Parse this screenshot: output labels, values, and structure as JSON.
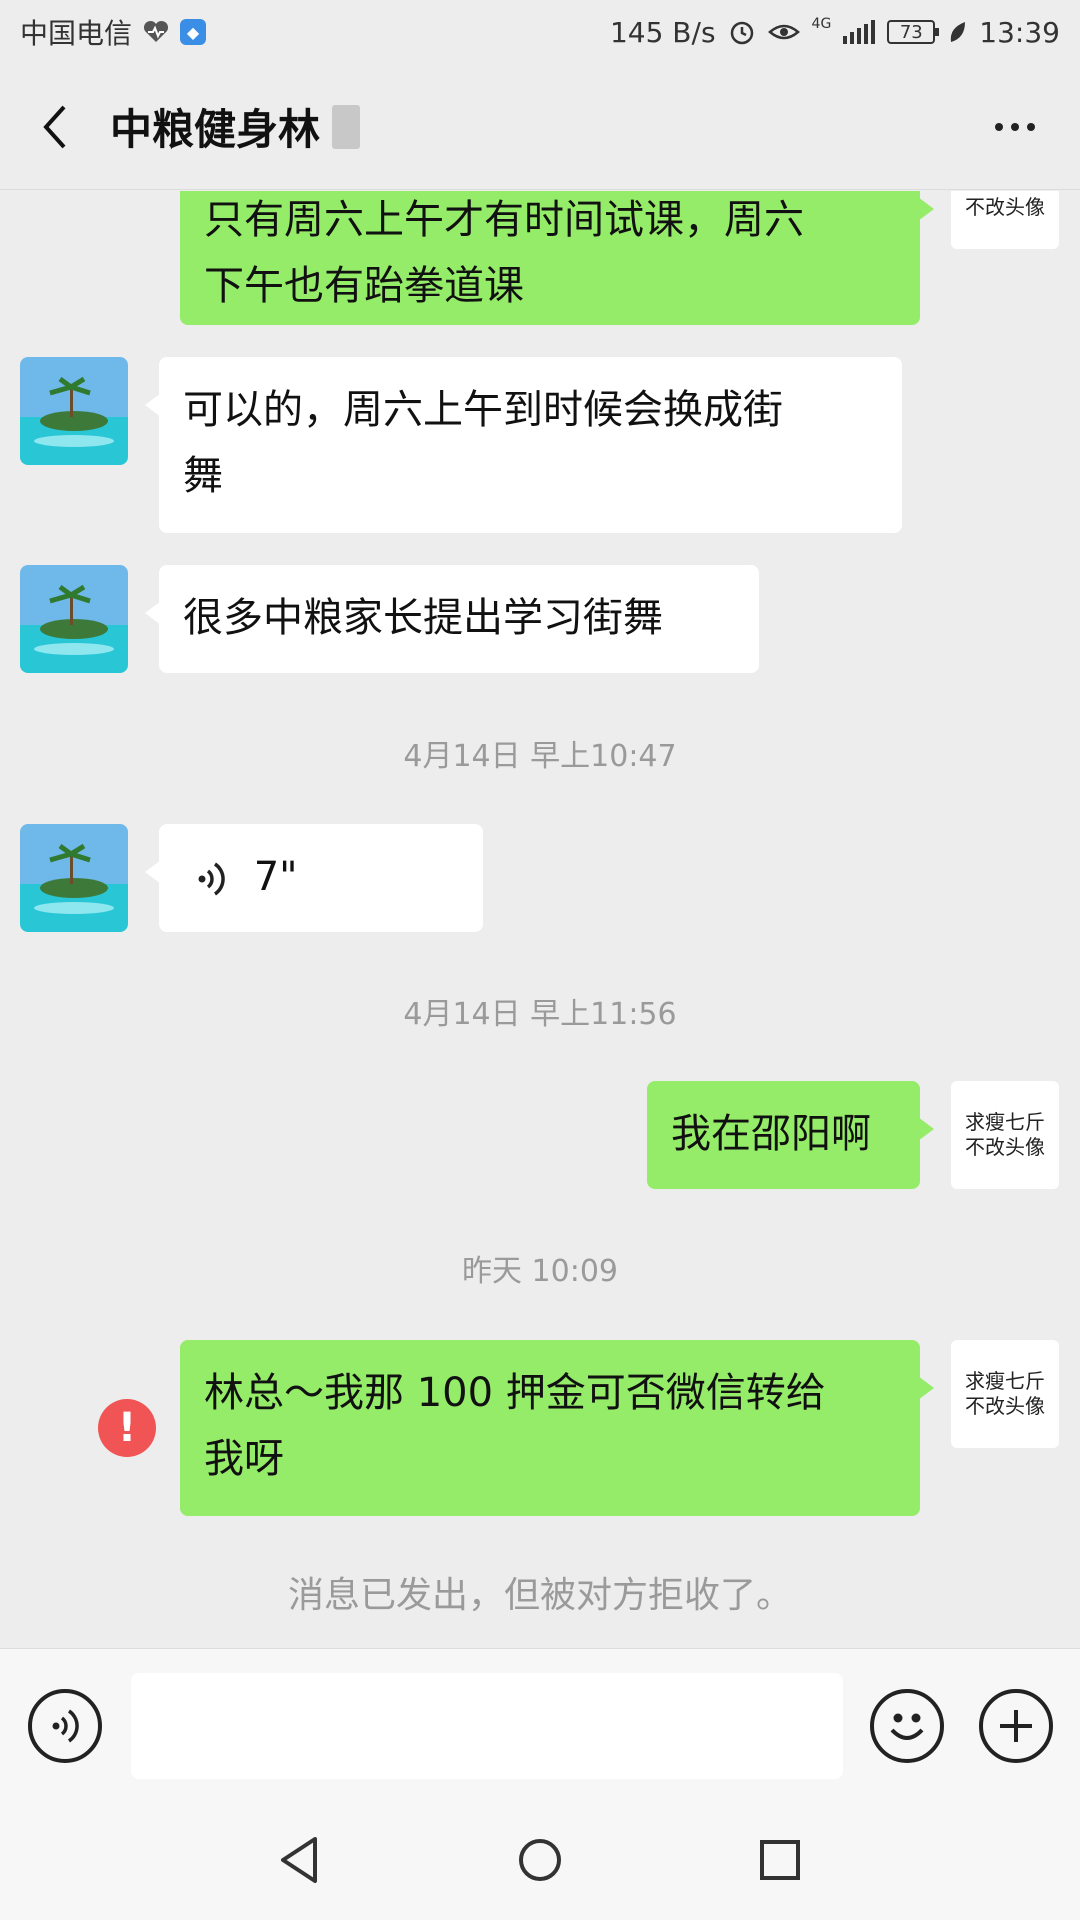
{
  "status_bar": {
    "carrier": "中国电信",
    "speed": "145 B/s",
    "network": "4G",
    "battery": "73",
    "time": "13:39"
  },
  "header": {
    "title": "中粮健身林"
  },
  "messages": [
    {
      "side": "right",
      "type": "text",
      "lines": [
        "只有周六上午才有时间试课，周六",
        "下午也有跆拳道课"
      ]
    },
    {
      "side": "left",
      "type": "text",
      "lines": [
        "可以的，周六上午到时候会换成街",
        "舞"
      ]
    },
    {
      "side": "left",
      "type": "text",
      "lines": [
        "很多中粮家长提出学习街舞"
      ]
    },
    {
      "type": "timestamp",
      "text": "4月14日 早上10:47"
    },
    {
      "side": "left",
      "type": "voice",
      "duration": "7\""
    },
    {
      "type": "timestamp",
      "text": "4月14日 早上11:56"
    },
    {
      "side": "right",
      "type": "text",
      "lines": [
        "我在邵阳啊"
      ]
    },
    {
      "type": "timestamp",
      "text": "昨天 10:09"
    },
    {
      "side": "right",
      "type": "text",
      "status": "failed",
      "lines": [
        "林总～我那 100 押金可否微信转给",
        "我呀"
      ]
    },
    {
      "type": "notice",
      "text": "消息已发出，但被对方拒收了。"
    }
  ],
  "self_avatar": {
    "line1": "求瘦七斤",
    "line2": "不改头像"
  },
  "error_mark": "!",
  "input_bar": {
    "placeholder": ""
  },
  "colors": {
    "sent_bubble": "#95ec69",
    "received_bubble": "#ffffff",
    "background": "#ededed",
    "error": "#f05454"
  },
  "icons": [
    "back-arrow-icon",
    "more-icon",
    "voice-mode-icon",
    "emoji-icon",
    "plus-icon",
    "nav-back-icon",
    "nav-home-icon",
    "nav-recents-icon"
  ]
}
